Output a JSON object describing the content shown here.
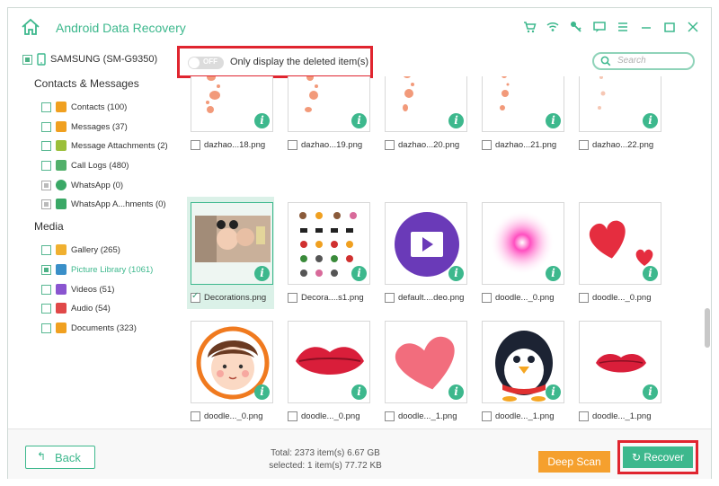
{
  "app": {
    "title": "Android Data Recovery"
  },
  "device": {
    "name": "SAMSUNG (SM-G9350)"
  },
  "filter": {
    "toggle_state": "OFF",
    "label": "Only display the deleted item(s)"
  },
  "search": {
    "placeholder": "Search"
  },
  "sidebar": {
    "sections": [
      {
        "title": "Contacts & Messages",
        "items": [
          {
            "label": "Contacts (100)",
            "icon": "contacts-icon",
            "color": "#f0a020"
          },
          {
            "label": "Messages (37)",
            "icon": "messages-icon",
            "color": "#f0a020"
          },
          {
            "label": "Message Attachments (2)",
            "icon": "attachment-icon",
            "color": "#9bbf3a"
          },
          {
            "label": "Call Logs (480)",
            "icon": "call-icon",
            "color": "#52b06a"
          },
          {
            "label": "WhatsApp (0)",
            "icon": "whatsapp-icon",
            "color": "#3aa866"
          },
          {
            "label": "WhatsApp A...hments (0)",
            "icon": "whatsapp-attachment-icon",
            "color": "#3aa866"
          }
        ]
      },
      {
        "title": "Media",
        "items": [
          {
            "label": "Gallery (265)",
            "icon": "gallery-icon",
            "color": "#f0b030"
          },
          {
            "label": "Picture Library (1061)",
            "icon": "picture-library-icon",
            "color": "#3a8fc8"
          },
          {
            "label": "Videos (51)",
            "icon": "videos-icon",
            "color": "#8a55d0"
          },
          {
            "label": "Audio (54)",
            "icon": "audio-icon",
            "color": "#e04848"
          },
          {
            "label": "Documents (323)",
            "icon": "documents-icon",
            "color": "#f0a020"
          }
        ]
      }
    ]
  },
  "files": [
    {
      "name": "dazhao...18.png",
      "thumb": "orange-splotches"
    },
    {
      "name": "dazhao...19.png",
      "thumb": "orange-splotches"
    },
    {
      "name": "dazhao...20.png",
      "thumb": "orange-splotches"
    },
    {
      "name": "dazhao...21.png",
      "thumb": "orange-splotches"
    },
    {
      "name": "dazhao...22.png",
      "thumb": "orange-splotches-faint"
    },
    {
      "name": "Decorations.png",
      "thumb": "photo-girl",
      "checked": true
    },
    {
      "name": "Decora....s1.png",
      "thumb": "stickers"
    },
    {
      "name": "default....deo.png",
      "thumb": "video-play"
    },
    {
      "name": "doodle..._0.png",
      "thumb": "pink-glow"
    },
    {
      "name": "doodle..._0.png",
      "thumb": "red-hearts"
    },
    {
      "name": "doodle..._0.png",
      "thumb": "boy-face"
    },
    {
      "name": "doodle..._0.png",
      "thumb": "red-lips"
    },
    {
      "name": "doodle..._1.png",
      "thumb": "pink-heart"
    },
    {
      "name": "doodle..._1.png",
      "thumb": "penguin"
    },
    {
      "name": "doodle..._1.png",
      "thumb": "red-lips-small"
    }
  ],
  "footer": {
    "back_label": "Back",
    "total": "Total: 2373 item(s) 6.67 GB",
    "selected": "selected: 1 item(s) 77.72 KB",
    "deep_scan_label": "Deep Scan",
    "recover_label": "Recover"
  },
  "colors": {
    "accent": "#3db88d",
    "highlight": "#e0252f",
    "deep_scan": "#f5a02e"
  }
}
